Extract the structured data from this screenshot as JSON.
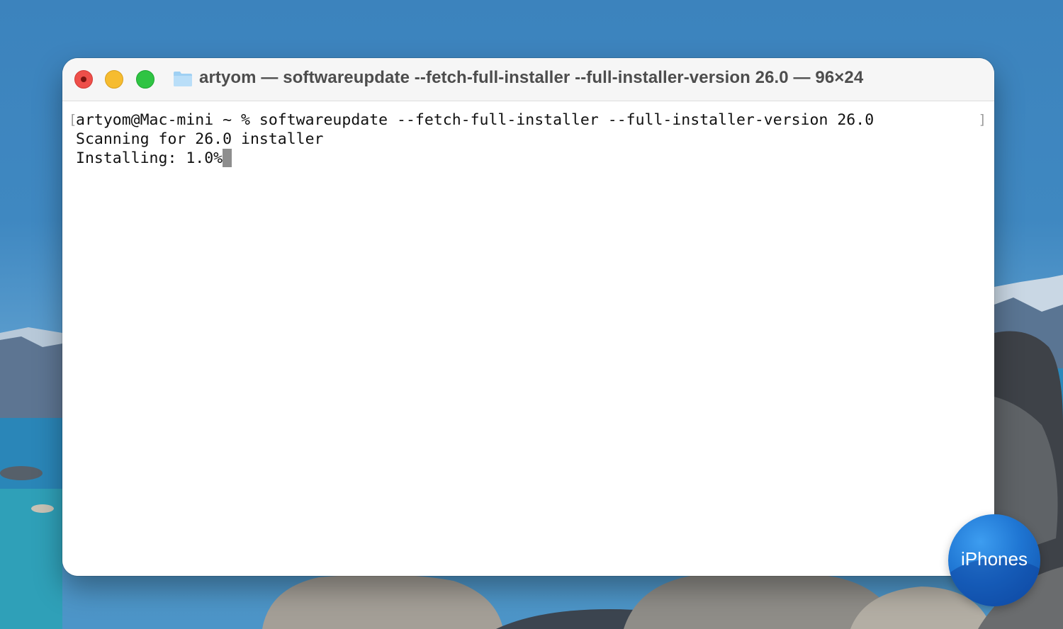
{
  "window": {
    "title": "artyom — softwareupdate --fetch-full-installer --full-installer-version 26.0 — 96×24",
    "folder_icon": "folder-icon"
  },
  "terminal": {
    "lines": [
      "artyom@Mac-mini ~ % softwareupdate --fetch-full-installer --full-installer-version 26.0",
      "Scanning for 26.0 installer",
      "Installing: 1.0%"
    ],
    "mark_left": "[",
    "mark_right": "]"
  },
  "watermark": {
    "text": "iPhones"
  },
  "colors": {
    "close": "#ee4f4a",
    "minimize": "#f6bc30",
    "zoom": "#2fc443",
    "terminal_background": "#ffffff",
    "badge": "#1f76d3"
  }
}
